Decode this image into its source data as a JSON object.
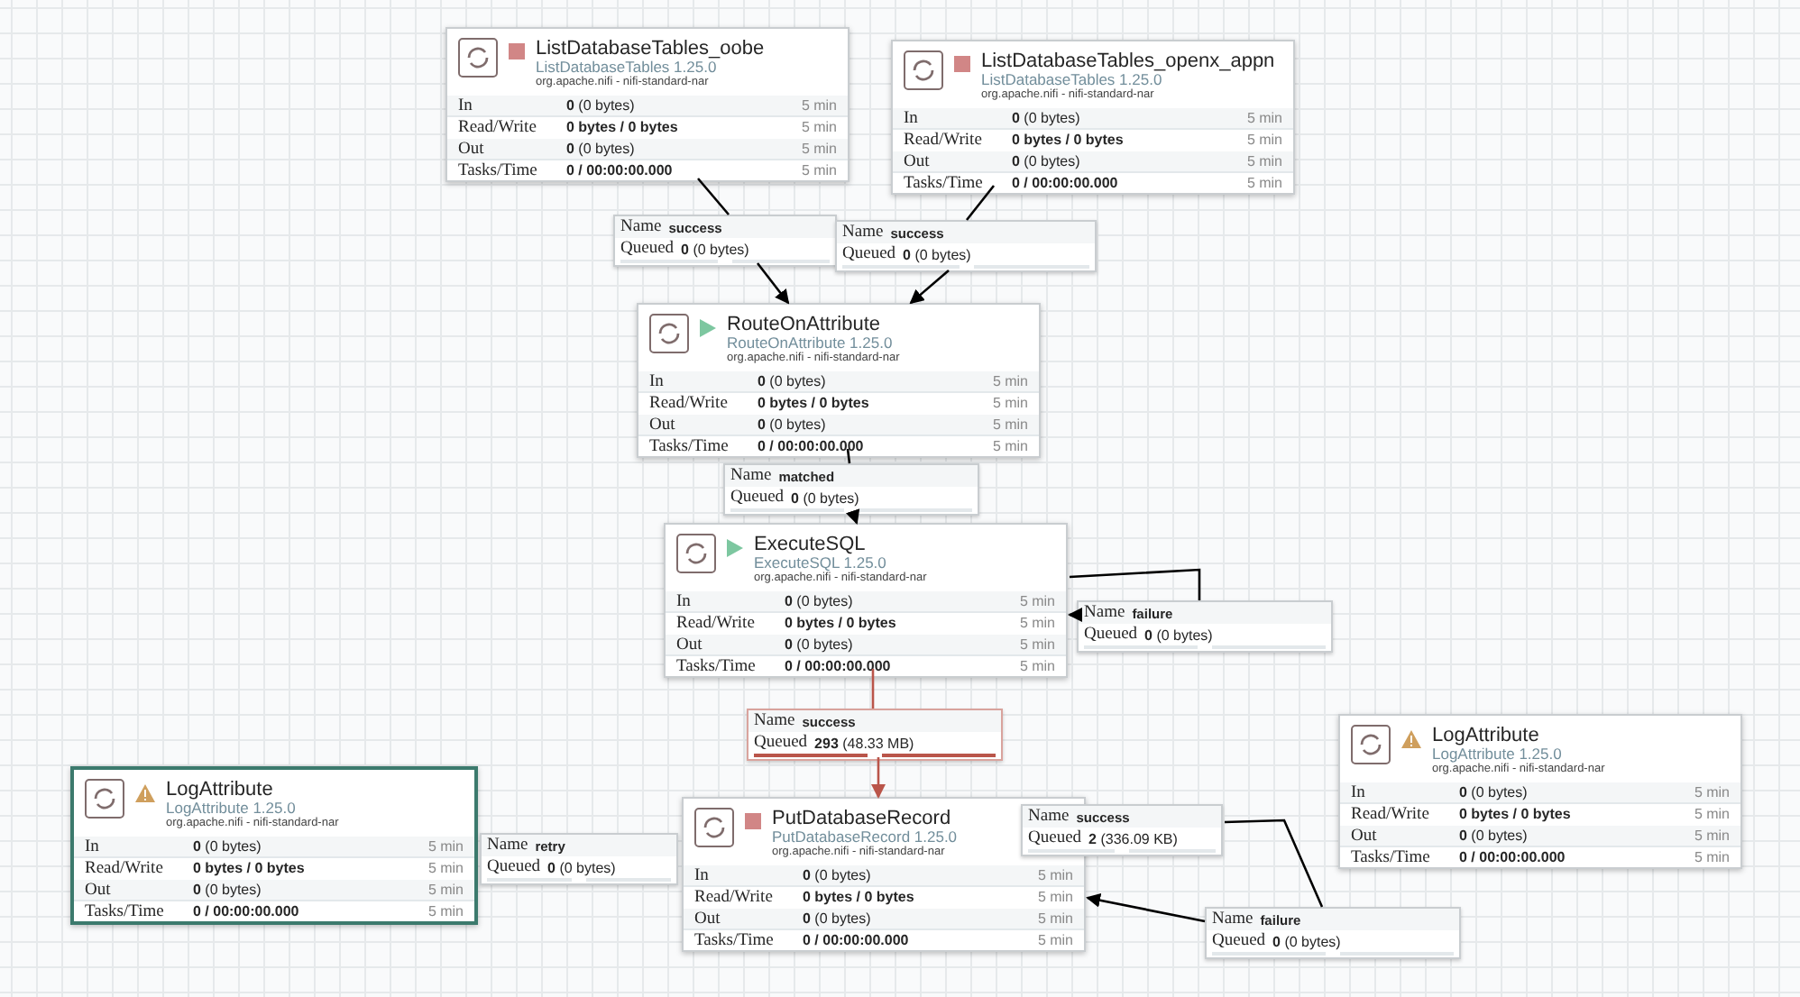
{
  "processors": [
    {
      "name": "ListDatabaseTables_oobe",
      "type": "ListDatabaseTables 1.25.0",
      "bundle": "org.apache.nifi - nifi-standard-nar",
      "running": false,
      "invalid": false,
      "selected": false,
      "stats": [
        {
          "label": "In",
          "value": "**0** (0 bytes)",
          "window": "5 min"
        },
        {
          "label": "Read/Write",
          "value": "**0 bytes / 0 bytes**",
          "window": "5 min"
        },
        {
          "label": "Out",
          "value": "**0** (0 bytes)",
          "window": "5 min"
        },
        {
          "label": "Tasks/Time",
          "value": "**0 / 00:00:00.000**",
          "window": "5 min"
        }
      ]
    },
    {
      "name": "ListDatabaseTables_openx_appn",
      "type": "ListDatabaseTables 1.25.0",
      "bundle": "org.apache.nifi - nifi-standard-nar",
      "running": false,
      "invalid": false,
      "selected": false,
      "stats": [
        {
          "label": "In",
          "value": "**0** (0 bytes)",
          "window": "5 min"
        },
        {
          "label": "Read/Write",
          "value": "**0 bytes / 0 bytes**",
          "window": "5 min"
        },
        {
          "label": "Out",
          "value": "**0** (0 bytes)",
          "window": "5 min"
        },
        {
          "label": "Tasks/Time",
          "value": "**0 / 00:00:00.000**",
          "window": "5 min"
        }
      ]
    },
    {
      "name": "RouteOnAttribute",
      "type": "RouteOnAttribute 1.25.0",
      "bundle": "org.apache.nifi - nifi-standard-nar",
      "running": true,
      "invalid": false,
      "selected": false,
      "stats": [
        {
          "label": "In",
          "value": "**0** (0 bytes)",
          "window": "5 min"
        },
        {
          "label": "Read/Write",
          "value": "**0 bytes / 0 bytes**",
          "window": "5 min"
        },
        {
          "label": "Out",
          "value": "**0** (0 bytes)",
          "window": "5 min"
        },
        {
          "label": "Tasks/Time",
          "value": "**0 / 00:00:00.000**",
          "window": "5 min"
        }
      ]
    },
    {
      "name": "ExecuteSQL",
      "type": "ExecuteSQL 1.25.0",
      "bundle": "org.apache.nifi - nifi-standard-nar",
      "running": true,
      "invalid": false,
      "selected": false,
      "stats": [
        {
          "label": "In",
          "value": "**0** (0 bytes)",
          "window": "5 min"
        },
        {
          "label": "Read/Write",
          "value": "**0 bytes / 0 bytes**",
          "window": "5 min"
        },
        {
          "label": "Out",
          "value": "**0** (0 bytes)",
          "window": "5 min"
        },
        {
          "label": "Tasks/Time",
          "value": "**0 / 00:00:00.000**",
          "window": "5 min"
        }
      ]
    },
    {
      "name": "PutDatabaseRecord",
      "type": "PutDatabaseRecord 1.25.0",
      "bundle": "org.apache.nifi - nifi-standard-nar",
      "running": false,
      "invalid": false,
      "selected": false,
      "stats": [
        {
          "label": "In",
          "value": "**0** (0 bytes)",
          "window": "5 min"
        },
        {
          "label": "Read/Write",
          "value": "**0 bytes / 0 bytes**",
          "window": "5 min"
        },
        {
          "label": "Out",
          "value": "**0** (0 bytes)",
          "window": "5 min"
        },
        {
          "label": "Tasks/Time",
          "value": "**0 / 00:00:00.000**",
          "window": "5 min"
        }
      ]
    },
    {
      "name": "LogAttribute",
      "type": "LogAttribute 1.25.0",
      "bundle": "org.apache.nifi - nifi-standard-nar",
      "invalid": true,
      "selected": true,
      "stats": [
        {
          "label": "In",
          "value": "**0** (0 bytes)",
          "window": "5 min"
        },
        {
          "label": "Read/Write",
          "value": "**0 bytes / 0 bytes**",
          "window": "5 min"
        },
        {
          "label": "Out",
          "value": "**0** (0 bytes)",
          "window": "5 min"
        },
        {
          "label": "Tasks/Time",
          "value": "**0 / 00:00:00.000**",
          "window": "5 min"
        }
      ]
    },
    {
      "name": "LogAttribute",
      "type": "LogAttribute 1.25.0",
      "bundle": "org.apache.nifi - nifi-standard-nar",
      "invalid": true,
      "selected": false,
      "stats": [
        {
          "label": "In",
          "value": "**0** (0 bytes)",
          "window": "5 min"
        },
        {
          "label": "Read/Write",
          "value": "**0 bytes / 0 bytes**",
          "window": "5 min"
        },
        {
          "label": "Out",
          "value": "**0** (0 bytes)",
          "window": "5 min"
        },
        {
          "label": "Tasks/Time",
          "value": "**0 / 00:00:00.000**",
          "window": "5 min"
        }
      ]
    }
  ],
  "connections": [
    {
      "name_label": "Name",
      "name": "success",
      "queued_label": "Queued",
      "queued": "**0** (0 bytes)",
      "full": false
    },
    {
      "name_label": "Name",
      "name": "success",
      "queued_label": "Queued",
      "queued": "**0** (0 bytes)",
      "full": false
    },
    {
      "name_label": "Name",
      "name": "matched",
      "queued_label": "Queued",
      "queued": "**0** (0 bytes)",
      "full": false
    },
    {
      "name_label": "Name",
      "name": "failure",
      "queued_label": "Queued",
      "queued": "**0** (0 bytes)",
      "full": false
    },
    {
      "name_label": "Name",
      "name": "success",
      "queued_label": "Queued",
      "queued": "**293** (48.33 MB)",
      "full": true
    },
    {
      "name_label": "Name",
      "name": "retry",
      "queued_label": "Queued",
      "queued": "**0** (0 bytes)",
      "full": false
    },
    {
      "name_label": "Name",
      "name": "success",
      "queued_label": "Queued",
      "queued": "**2** (336.09 KB)",
      "full": false
    },
    {
      "name_label": "Name",
      "name": "failure",
      "queued_label": "Queued",
      "queued": "**0** (0 bytes)",
      "full": false
    }
  ]
}
